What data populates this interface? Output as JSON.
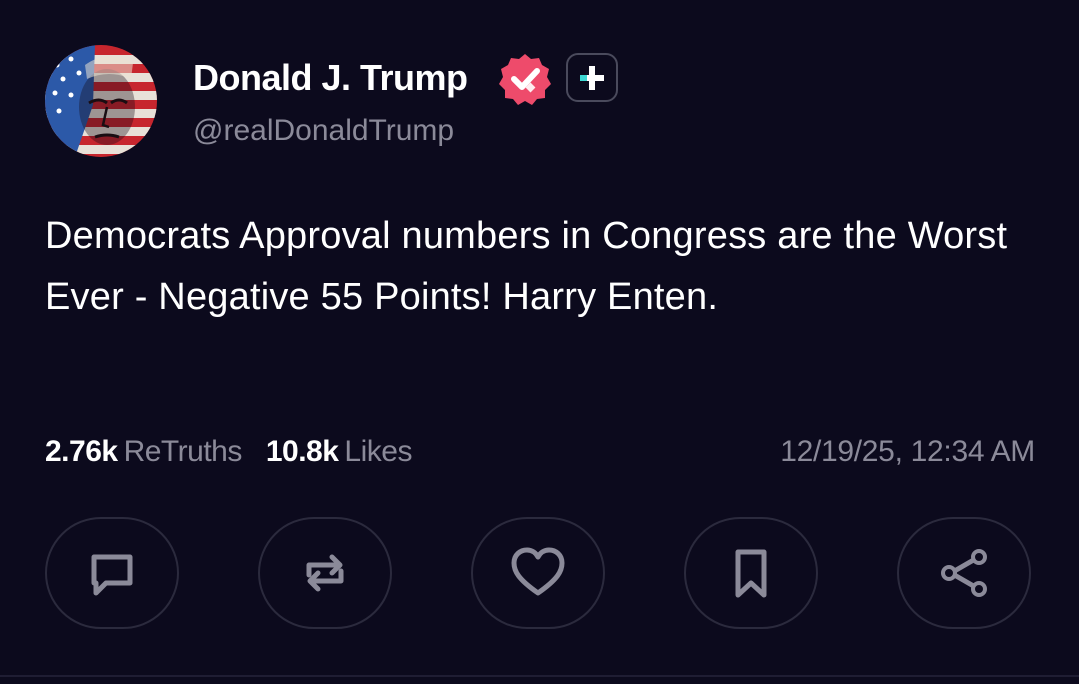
{
  "author": {
    "display_name": "Donald J. Trump",
    "handle": "@realDonaldTrump",
    "avatar_icon": "flag-portrait-avatar",
    "verified_icon": "verified-badge-icon",
    "verified_color": "#ee4b6b",
    "plus_icon": "plus-icon",
    "plus_color": "#3ed8d4"
  },
  "post": {
    "text": "Democrats Approval numbers in Congress are the Worst Ever - Negative 55 Points! Harry Enten."
  },
  "stats": {
    "retruths_count": "2.76k",
    "retruths_label": "ReTruths",
    "likes_count": "10.8k",
    "likes_label": "Likes",
    "timestamp": "12/19/25, 12:34 AM"
  },
  "actions": [
    {
      "icon": "reply-icon"
    },
    {
      "icon": "retruth-icon"
    },
    {
      "icon": "like-heart-icon"
    },
    {
      "icon": "bookmark-icon"
    },
    {
      "icon": "share-icon"
    }
  ],
  "colors": {
    "background": "#0c0a1d",
    "primary_text": "#ffffff",
    "secondary_text": "#8b8a99",
    "button_border": "#2b2a3d",
    "icon_color": "#8b8a99"
  }
}
